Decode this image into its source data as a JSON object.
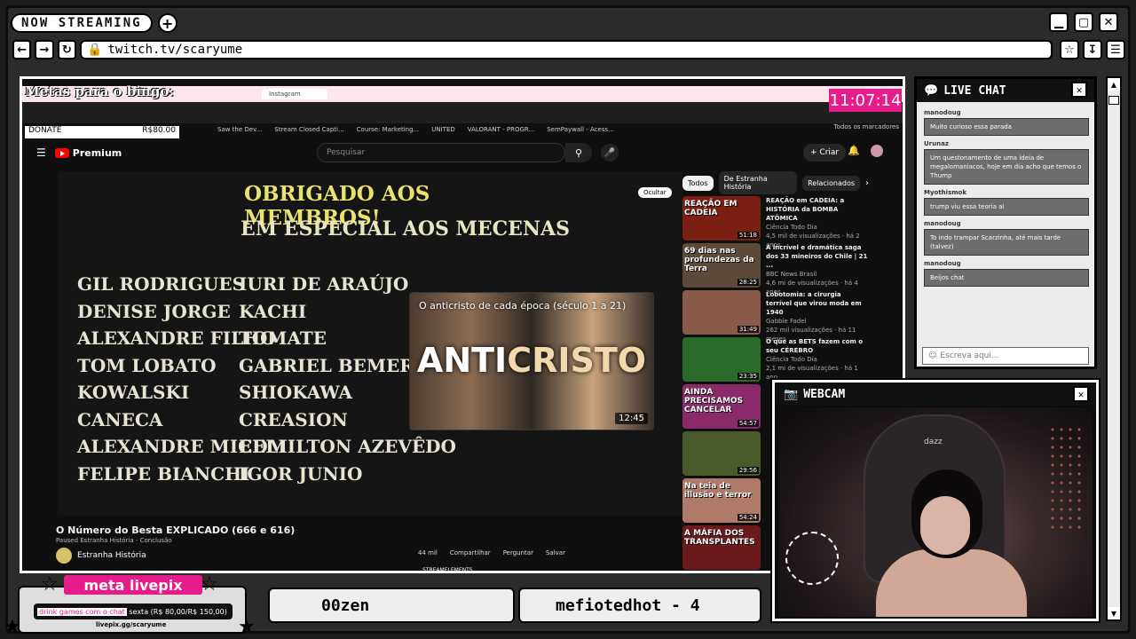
{
  "top_bar": {
    "now_streaming": "NOW STREAMING",
    "plus": "+",
    "controls": [
      "▁",
      "▢",
      "✕"
    ]
  },
  "address_bar": {
    "url": "twitch.tv/scaryume"
  },
  "overlay": {
    "bingo_title": "Metas para o bingo:",
    "clock": "11:07:14",
    "donate_label": "DONATE",
    "donate_value": "R$80.00"
  },
  "browser": {
    "tabs": [
      "Instagram"
    ],
    "bookmarks": [
      "Saw the Dev...",
      "Stream Closed Capti...",
      "Course: Marketing...",
      "UNITED",
      "VALORANT - PROGR...",
      "SemPaywall - Acess..."
    ],
    "bookmarks_right": "Todos os marcadores"
  },
  "youtube": {
    "logo": "Premium",
    "search_placeholder": "Pesquisar",
    "create": "Criar",
    "video": {
      "thanks_title": "OBRIGADO AOS MEMBROS!",
      "thanks_sub": "EM ESPECIAL AOS MECENAS",
      "names_col1": [
        "GIL RODRIGUES",
        "DENISE JORGE",
        "ALEXANDRE FILHO",
        "TOM LOBATO",
        "KOWALSKI",
        "CANECA",
        "ALEXANDRE MICELI",
        "FELIPE BIANCHI"
      ],
      "names_col2": [
        "IURI DE ARAÚJO",
        "KACHI",
        "TOMATE",
        "GABRIEL BEMERGUY",
        "SHIOKAWA",
        "CREASION",
        "EDMILTON AZEVÊDO",
        "IGOR JUNIO"
      ],
      "ocultar": "Ocultar",
      "endcard_title": "O anticristo de cada época (século 1 a 21)",
      "endcard_big_1": "ANTI",
      "endcard_big_2": "CRISTO",
      "endcard_duration": "12:45"
    },
    "title": "O Número do Besta EXPLICADO (666 e 616)",
    "paused": "Paused Estranha História - Conclusão",
    "channel": "Estranha História",
    "actions": [
      "44 mil",
      "Compartilhar",
      "Perguntar",
      "Salvar"
    ],
    "chips": [
      "Todos",
      "De Estranha História",
      "Relacionados"
    ],
    "recommendations": [
      {
        "thumb_text": "REAÇÃO EM CADEIA",
        "duration": "51:18",
        "title": "REAÇÃO em CADEIA: a HISTÓRIA da BOMBA ATÔMICA",
        "channel": "Ciência Todo Dia",
        "meta": "4,5 mil de visualizações · há 2 anos",
        "color": "#7a1f12"
      },
      {
        "thumb_text": "69 dias nas profundezas da Terra",
        "duration": "28:25",
        "title": "A incrível e dramática saga dos 33 mineiros do Chile | 21 ...",
        "channel": "BBC News Brasil",
        "meta": "4,6 mi de visualizações · há 4 anos",
        "color": "#5b4a3a"
      },
      {
        "thumb_text": "",
        "duration": "31:49",
        "title": "Lobotomia: a cirurgia terrível que virou moda em 1940",
        "channel": "Gabbie Fadel",
        "meta": "262 mil visualizações · há 11 meses",
        "color": "#8a5a4a"
      },
      {
        "thumb_text": "",
        "duration": "23:35",
        "title": "O que as BETS fazem com o seu CÉREBRO",
        "channel": "Ciência Todo Dia",
        "meta": "2,1 mi de visualizações · há 1 ano",
        "color": "#2a6a2a"
      },
      {
        "thumb_text": "AINDA PRECISAMOS CANCELAR",
        "duration": "54:57",
        "title": "",
        "channel": "",
        "meta": "",
        "color": "#8a2a6a"
      },
      {
        "thumb_text": "",
        "duration": "29:56",
        "title": "",
        "channel": "",
        "meta": "",
        "color": "#4a5a2a"
      },
      {
        "thumb_text": "Na teia de illusão e terror",
        "duration": "54:24",
        "title": "",
        "channel": "",
        "meta": "",
        "color": "#b07a6a"
      },
      {
        "thumb_text": "A MÁFIA DOS TRANSPLANTES",
        "duration": "",
        "title": "",
        "channel": "",
        "meta": "",
        "color": "#6a1a1a"
      }
    ]
  },
  "livepix": {
    "title": "meta livepix",
    "goal": "drink games com o chat",
    "goal_prefix": "sexta",
    "goal_amount": "(R$ 80,00/R$ 150,00)",
    "link": "livepix.gg/scaryume"
  },
  "tickers": [
    "00zen",
    "mefiotedhot - 4"
  ],
  "streamelements": "STREAMELEMENTS",
  "live_chat": {
    "title": "LIVE CHAT",
    "messages": [
      {
        "user": "manodoug",
        "text": "Muito curioso essa parada"
      },
      {
        "user": "Urunaz",
        "text": "Um questonamento de uma ideia de megalomaniacos, hoje em dia acho que temos o Thump"
      },
      {
        "user": "Myothismok",
        "text": "trump viu essa teoria ai"
      },
      {
        "user": "manodoug",
        "text": "To indo trampar Scarzinha, até mais tarde (talvez)"
      },
      {
        "user": "manodoug",
        "text": "Beijos chat"
      }
    ],
    "input_placeholder": "Escreva aqui..."
  },
  "webcam": {
    "title": "WEBCAM",
    "chair_brand": "dazz"
  },
  "colors": {
    "accent_pink": "#e61c8a",
    "yt_red": "#ff0000",
    "chat_bubble": "#6d6d6d",
    "thanks_yellow": "#e9e26c"
  }
}
